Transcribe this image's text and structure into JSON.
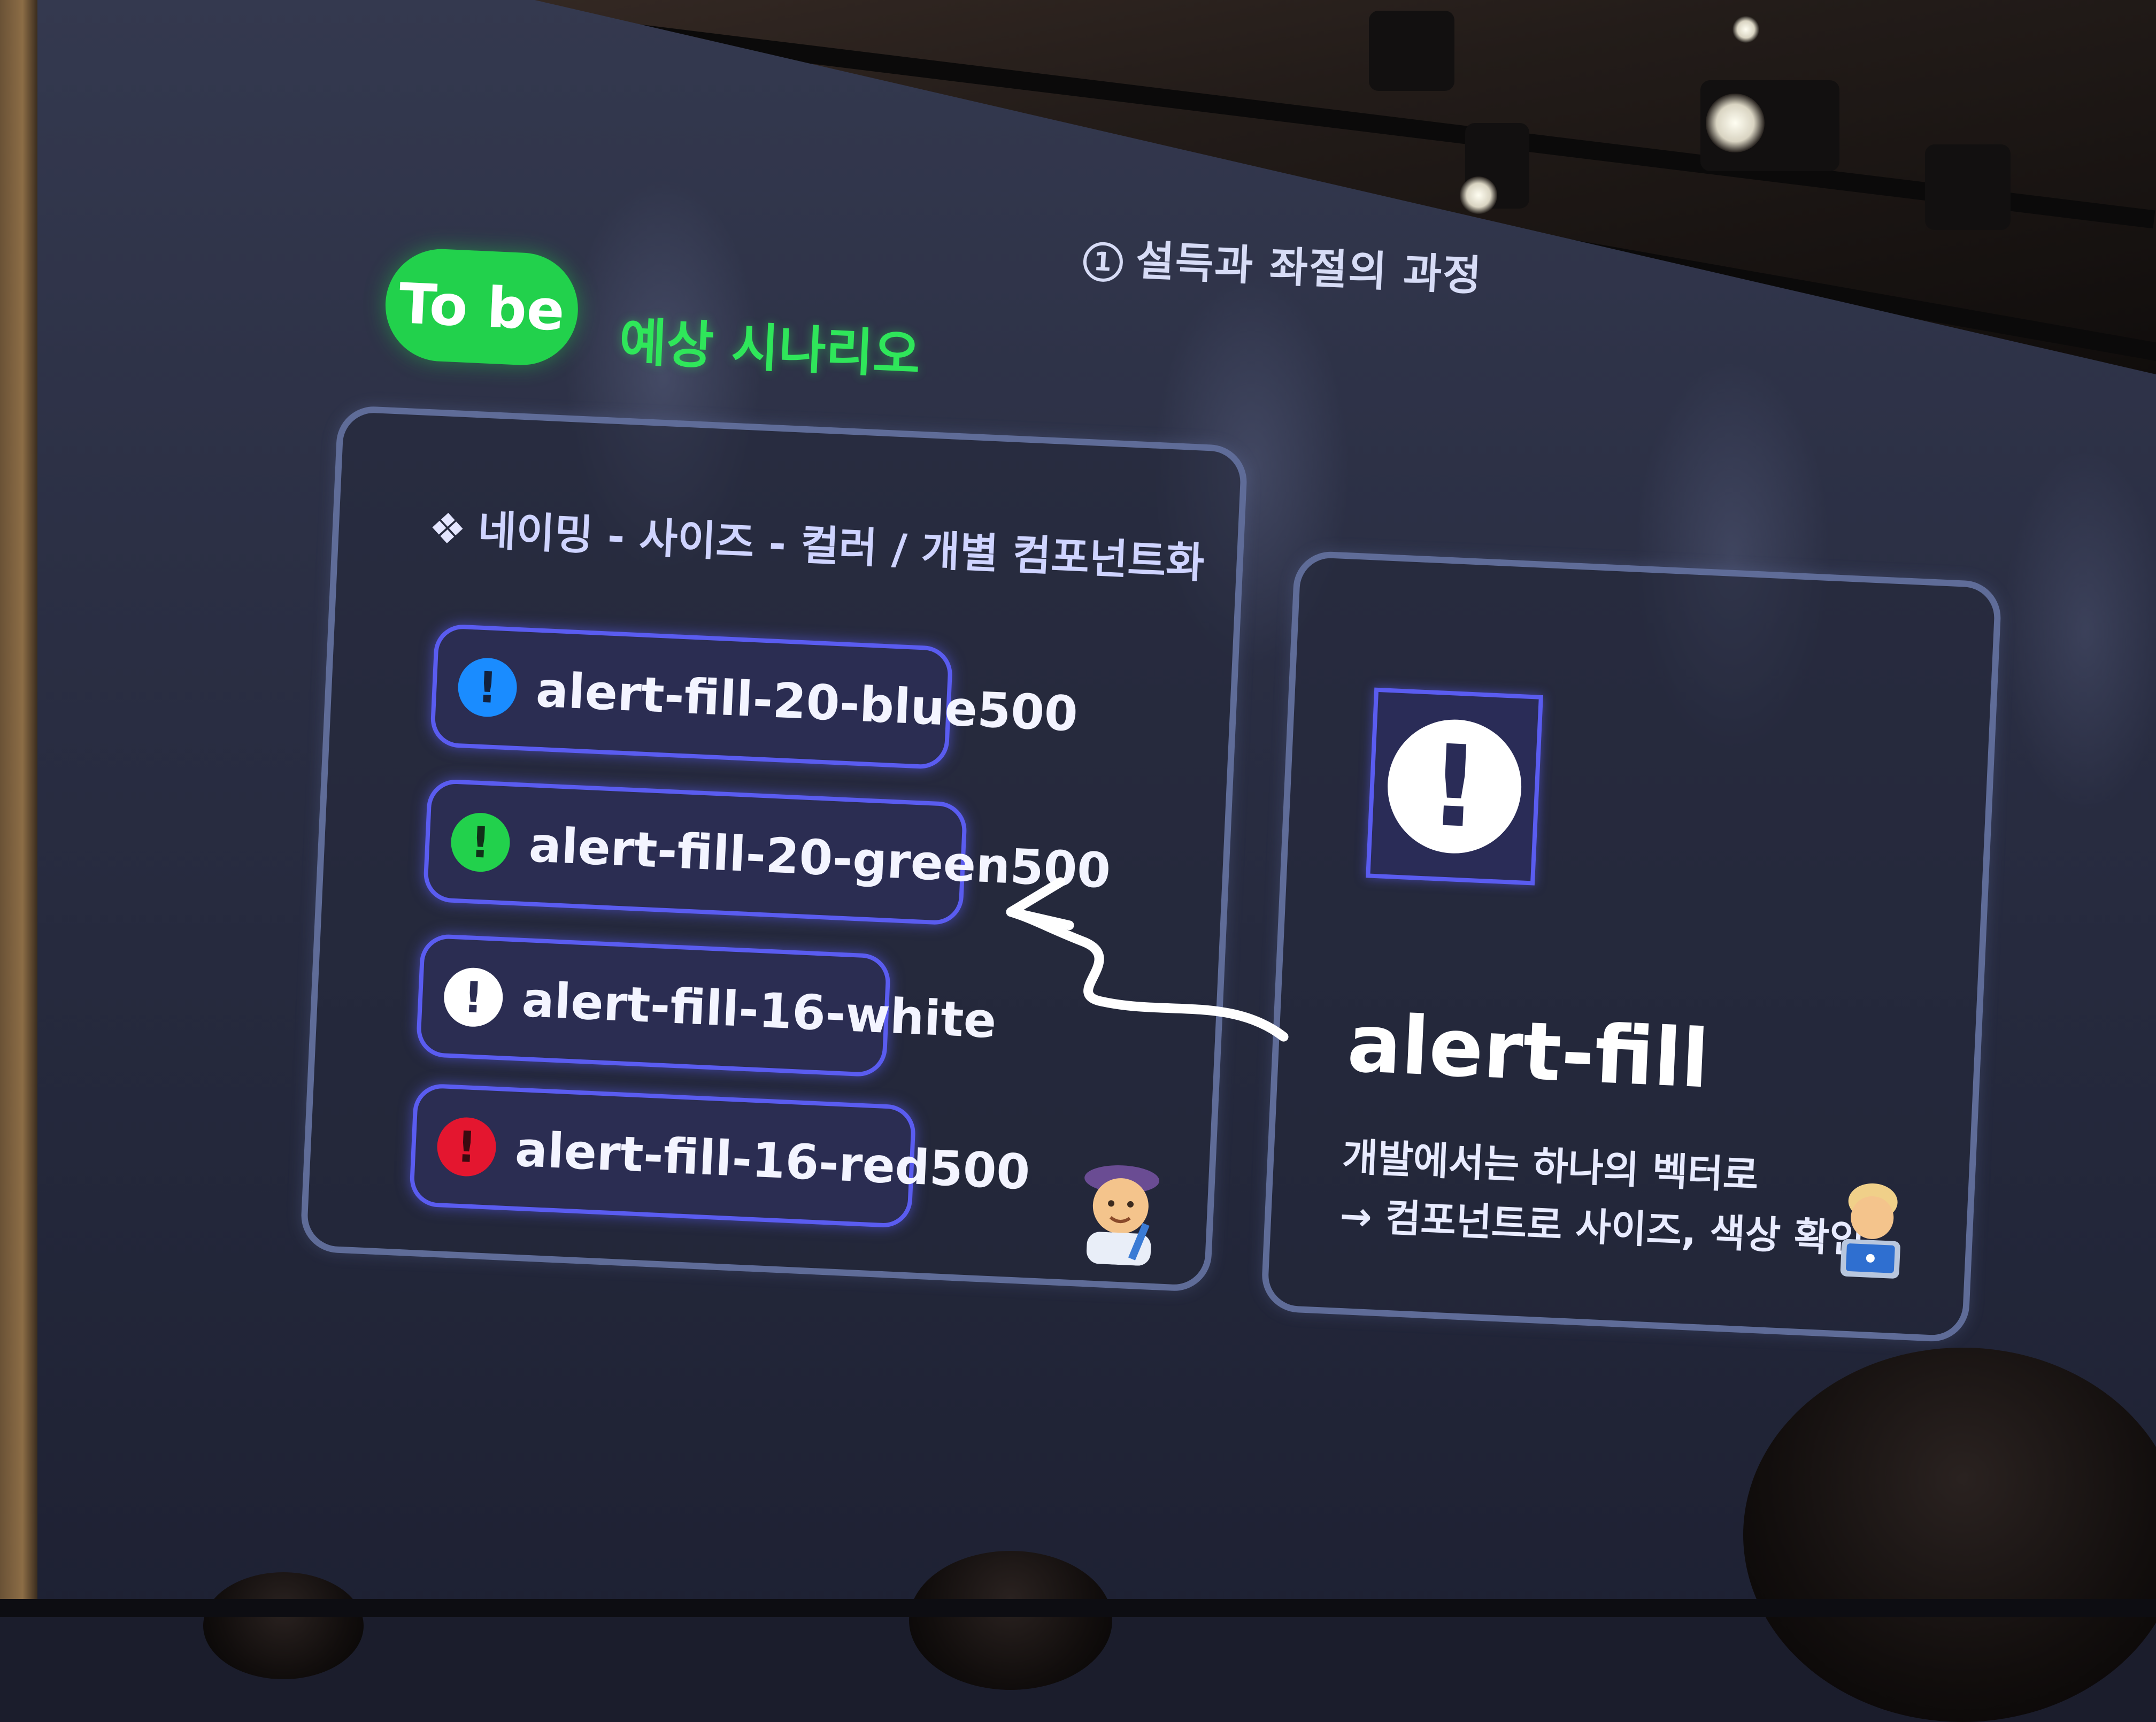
{
  "slide": {
    "section": {
      "number": "1",
      "title": "설득과 좌절의 과정"
    },
    "badge": "To be",
    "scenario": "예상 시나리오",
    "left_card": {
      "rule": "네이밍 - 사이즈 - 컬러 / 개별 컴포넌트화",
      "rule_icon": "diamond-grid-icon",
      "items": [
        {
          "label": "alert-fill-20-blue500",
          "color": "#1a8cff"
        },
        {
          "label": "alert-fill-20-green500",
          "color": "#22d14c"
        },
        {
          "label": "alert-fill-16-white",
          "color": "#ffffff"
        },
        {
          "label": "alert-fill-16-red500",
          "color": "#e4162f"
        }
      ],
      "alert_glyph": "!",
      "emoji": "artist-emoji"
    },
    "right_card": {
      "icon_glyph": "!",
      "title": "alert-fill",
      "description_line1": "개발에서는 하나의 벡터로",
      "description_line2": "→ 컴포넌트로 사이즈, 색상 확인",
      "emoji": "technologist-emoji"
    },
    "accent_green": "#22d14c",
    "accent_purple": "#5a5cf0"
  }
}
